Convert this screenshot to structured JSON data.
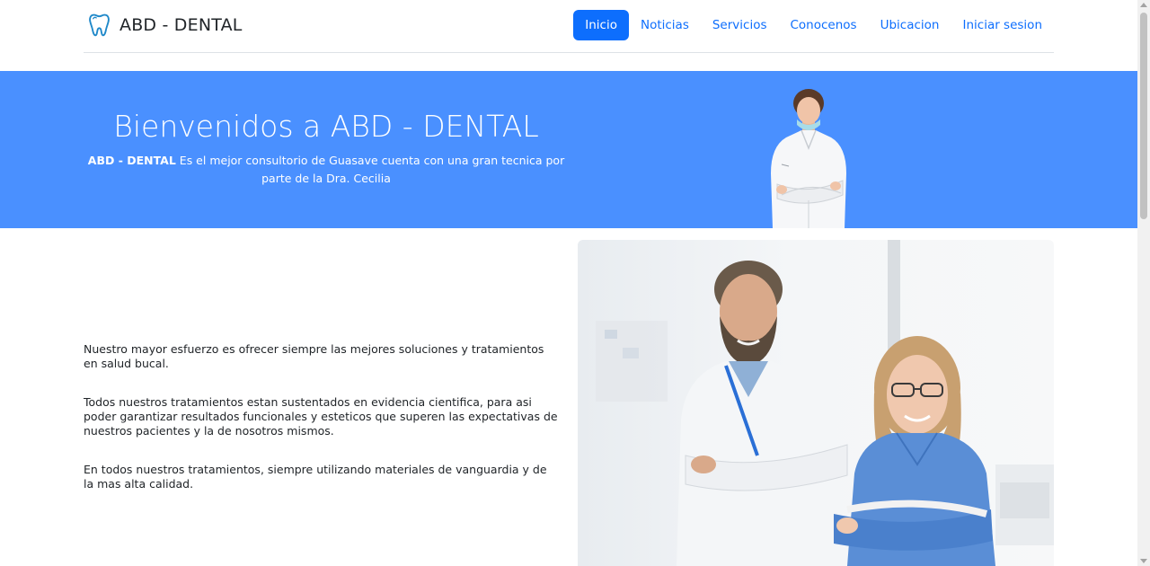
{
  "brand": {
    "name": "ABD - DENTAL",
    "icon": "tooth-icon",
    "icon_color": "#1e88c9"
  },
  "nav": {
    "items": [
      {
        "label": "Inicio",
        "active": true
      },
      {
        "label": "Noticias",
        "active": false
      },
      {
        "label": "Servicios",
        "active": false
      },
      {
        "label": "Conocenos",
        "active": false
      },
      {
        "label": "Ubicacion",
        "active": false
      },
      {
        "label": "Iniciar sesion",
        "active": false
      }
    ]
  },
  "hero": {
    "title": "Bienvenidos a ABD - DENTAL",
    "subtitle_bold": "ABD - DENTAL",
    "subtitle_rest": " Es el mejor consultorio de Guasave cuenta con una gran tecnica por parte de la Dra. Cecilia",
    "background": "#4a90ff"
  },
  "content": {
    "paragraphs": [
      "Nuestro mayor esfuerzo es ofrecer siempre las mejores soluciones y tratamientos en salud bucal.",
      "Todos nuestros tratamientos estan sustentados en evidencia cientifica, para asi poder garantizar resultados funcionales y esteticos que superen las expectativas de nuestros pacientes y la de nosotros mismos.",
      "En todos nuestros tratamientos, siempre utilizando materiales de vanguardia y de la mas alta calidad."
    ]
  },
  "colors": {
    "primary": "#0d6efd",
    "hero_blue": "#4a90ff"
  }
}
